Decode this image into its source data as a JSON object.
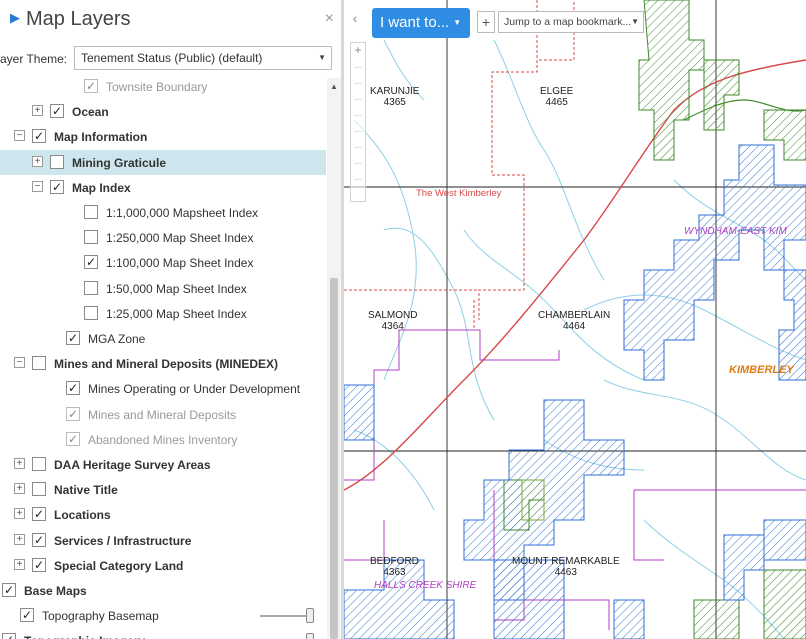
{
  "panel": {
    "title": "Map Layers",
    "close_icon": "×",
    "theme_label": "ayer Theme:",
    "theme_value": "Tenement Status (Public) (default)"
  },
  "tree": [
    {
      "label": "Townsite Boundary",
      "level": 2,
      "checked": true,
      "expander": null,
      "bold": false,
      "dim": true
    },
    {
      "label": "Ocean",
      "level": 1,
      "checked": true,
      "expander": "+",
      "bold": true,
      "dim": false
    },
    {
      "label": "Map Information",
      "level": 0,
      "checked": true,
      "expander": "−",
      "bold": true,
      "dim": false
    },
    {
      "label": "Mining Graticule",
      "level": 1,
      "checked": false,
      "expander": "+",
      "bold": true,
      "dim": false,
      "selected": true
    },
    {
      "label": "Map Index",
      "level": 1,
      "checked": true,
      "expander": "−",
      "bold": true,
      "dim": false
    },
    {
      "label": "1:1,000,000 Mapsheet Index",
      "level": 2,
      "checked": false,
      "expander": null,
      "bold": false,
      "dim": false
    },
    {
      "label": "1:250,000 Map Sheet Index",
      "level": 2,
      "checked": false,
      "expander": null,
      "bold": false,
      "dim": false
    },
    {
      "label": "1:100,000 Map Sheet Index",
      "level": 2,
      "checked": true,
      "expander": null,
      "bold": false,
      "dim": false
    },
    {
      "label": "1:50,000 Map Sheet Index",
      "level": 2,
      "checked": false,
      "expander": null,
      "bold": false,
      "dim": false
    },
    {
      "label": "1:25,000 Map Sheet Index",
      "level": 2,
      "checked": false,
      "expander": null,
      "bold": false,
      "dim": false
    },
    {
      "label": "MGA Zone",
      "level": 1.5,
      "checked": true,
      "expander": null,
      "bold": false,
      "dim": false
    },
    {
      "label": "Mines and Mineral Deposits (MINEDEX)",
      "level": 0,
      "checked": false,
      "expander": "−",
      "bold": true,
      "dim": false
    },
    {
      "label": "Mines Operating or Under Development",
      "level": 1.5,
      "checked": true,
      "expander": null,
      "bold": false,
      "dim": false
    },
    {
      "label": "Mines and Mineral Deposits",
      "level": 1.5,
      "checked": true,
      "expander": null,
      "bold": false,
      "dim": true
    },
    {
      "label": "Abandoned Mines Inventory",
      "level": 1.5,
      "checked": true,
      "expander": null,
      "bold": false,
      "dim": true
    },
    {
      "label": "DAA Heritage Survey Areas",
      "level": 0,
      "checked": false,
      "expander": "+",
      "bold": true,
      "dim": false
    },
    {
      "label": "Native Title",
      "level": 0,
      "checked": false,
      "expander": "+",
      "bold": true,
      "dim": false
    },
    {
      "label": "Locations",
      "level": 0,
      "checked": true,
      "expander": "+",
      "bold": true,
      "dim": false
    },
    {
      "label": "Services / Infrastructure",
      "level": 0,
      "checked": true,
      "expander": "+",
      "bold": true,
      "dim": false
    },
    {
      "label": "Special Category Land",
      "level": 0,
      "checked": true,
      "expander": "+",
      "bold": true,
      "dim": false
    },
    {
      "label": "Base Maps",
      "level": -1,
      "checked": true,
      "expander": null,
      "bold": true,
      "dim": false
    },
    {
      "label": "Topography Basemap",
      "level": -0.5,
      "checked": true,
      "expander": null,
      "bold": false,
      "dim": false,
      "slider": true
    },
    {
      "label": "Topographic Imagery",
      "level": -1,
      "checked": true,
      "expander": null,
      "bold": true,
      "dim": false,
      "slider": true,
      "partial": true
    }
  ],
  "toolbar": {
    "collapse_icon": "‹",
    "want_label": "I want to...",
    "bookmark_add": "+",
    "bookmark_placeholder": "Jump to a map bookmark..."
  },
  "map_labels": {
    "karunjie": "KARUNJIE",
    "karunjie_num": "4365",
    "elgee": "ELGEE",
    "elgee_num": "4465",
    "salmond": "SALMOND",
    "salmond_num": "4364",
    "chamberlain": "CHAMBERLAIN",
    "chamberlain_num": "4464",
    "bedford": "BEDFORD",
    "bedford_num": "4363",
    "mount_remarkable": "MOUNT REMARKABLE",
    "mount_remarkable_num": "4463",
    "west_kimberley": "The West Kimberley",
    "wyndham": "WYNDHAM-EAST KIM",
    "kimberley": "KIMBERLEY",
    "halls_creek": "HALLS CREEK SHIRE"
  },
  "colors": {
    "accent": "#2f8de4",
    "selection": "#cde6ee",
    "tenement_blue": "#2f6fd6",
    "tenement_green": "#3c8a2a",
    "boundary_red": "#d94848",
    "shire_purple": "#b040c0",
    "river": "#8ecfe6",
    "kimberley_orange": "#e07b14"
  }
}
